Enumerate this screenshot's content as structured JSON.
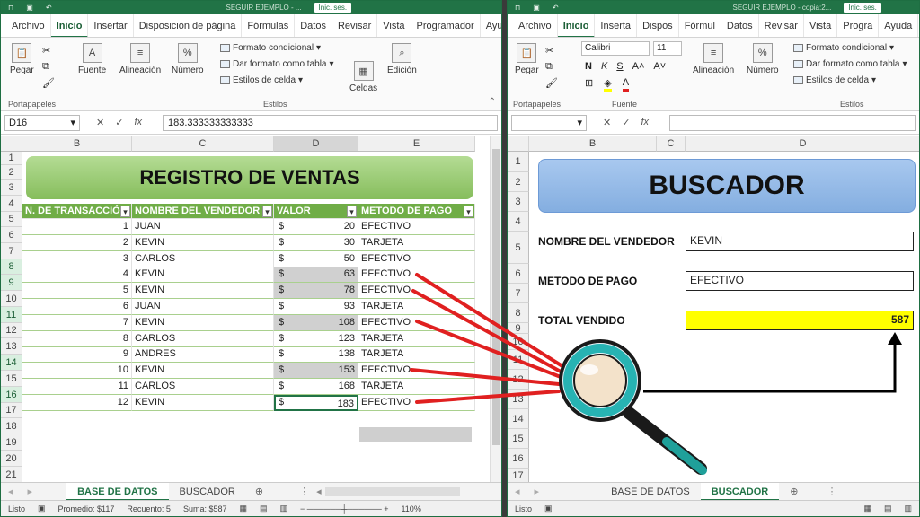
{
  "left": {
    "title": "SEGUIR EJEMPLO - ...",
    "signin": "Inic. ses.",
    "tabs": [
      "Archivo",
      "Inicio",
      "Insertar",
      "Disposición de página",
      "Fórmulas",
      "Datos",
      "Revisar",
      "Vista",
      "Programador",
      "Ayuda"
    ],
    "ribbon": {
      "pegar": "Pegar",
      "portapapeles": "Portapapeles",
      "fuente": "Fuente",
      "alineacion": "Alineación",
      "numero": "Número",
      "formato_condicional": "Formato condicional",
      "dar_formato": "Dar formato como tabla",
      "estilos_celda": "Estilos de celda",
      "estilos": "Estilos",
      "celdas": "Celdas",
      "edicion": "Edición"
    },
    "namebox": "D16",
    "formula": "183.333333333333",
    "columns": [
      "B",
      "C",
      "D",
      "E"
    ],
    "banner": "REGISTRO DE VENTAS",
    "headers": [
      "N. DE TRANSACCIÓN",
      "NOMBRE DEL VENDEDOR",
      "VALOR",
      "METODO DE PAGO"
    ],
    "rows": [
      {
        "n": "1",
        "name": "JUAN",
        "cur": "$",
        "val": "20",
        "pay": "EFECTIVO"
      },
      {
        "n": "2",
        "name": "KEVIN",
        "cur": "$",
        "val": "30",
        "pay": "TARJETA"
      },
      {
        "n": "3",
        "name": "CARLOS",
        "cur": "$",
        "val": "50",
        "pay": "EFECTIVO"
      },
      {
        "n": "4",
        "name": "KEVIN",
        "cur": "$",
        "val": "63",
        "pay": "EFECTIVO"
      },
      {
        "n": "5",
        "name": "KEVIN",
        "cur": "$",
        "val": "78",
        "pay": "EFECTIVO"
      },
      {
        "n": "6",
        "name": "JUAN",
        "cur": "$",
        "val": "93",
        "pay": "TARJETA"
      },
      {
        "n": "7",
        "name": "KEVIN",
        "cur": "$",
        "val": "108",
        "pay": "EFECTIVO"
      },
      {
        "n": "8",
        "name": "CARLOS",
        "cur": "$",
        "val": "123",
        "pay": "TARJETA"
      },
      {
        "n": "9",
        "name": "ANDRES",
        "cur": "$",
        "val": "138",
        "pay": "TARJETA"
      },
      {
        "n": "10",
        "name": "KEVIN",
        "cur": "$",
        "val": "153",
        "pay": "EFECTIVO"
      },
      {
        "n": "11",
        "name": "CARLOS",
        "cur": "$",
        "val": "168",
        "pay": "TARJETA"
      },
      {
        "n": "12",
        "name": "KEVIN",
        "cur": "$",
        "val": "183",
        "pay": "EFECTIVO"
      }
    ],
    "rownums": [
      "1",
      "2",
      "3",
      "4",
      "5",
      "6",
      "7",
      "8",
      "9",
      "10",
      "11",
      "12",
      "13",
      "14",
      "15",
      "16",
      "17",
      "18",
      "19",
      "20",
      "21"
    ],
    "sheets": [
      "BASE DE DATOS",
      "BUSCADOR"
    ],
    "status": {
      "ready": "Listo",
      "promedio": "Promedio: $117",
      "recuento": "Recuento: 5",
      "suma": "Suma: $587",
      "zoom": "110%"
    }
  },
  "right": {
    "title": "SEGUIR EJEMPLO - copia:2...",
    "signin": "Inic. ses.",
    "tabs": [
      "Archivo",
      "Inicio",
      "Inserta",
      "Dispos",
      "Fórmul",
      "Datos",
      "Revisar",
      "Vista",
      "Progra",
      "Ayuda"
    ],
    "ribbon": {
      "pegar": "Pegar",
      "portapapeles": "Portapapeles",
      "font": "Calibri",
      "size": "11",
      "fuente": "Fuente",
      "alineacion": "Alineación",
      "numero": "Número",
      "formato_condicional": "Formato condicional",
      "dar_formato": "Dar formato como tabla",
      "estilos_celda": "Estilos de celda",
      "estilos": "Estilos"
    },
    "columns": [
      "B",
      "C",
      "D"
    ],
    "banner": "BUSCADOR",
    "fields": {
      "vendedor_label": "NOMBRE DEL VENDEDOR",
      "vendedor_value": "KEVIN",
      "metodo_label": "METODO DE PAGO",
      "metodo_value": "EFECTIVO",
      "total_label": "TOTAL VENDIDO",
      "total_value": "587"
    },
    "rownums": [
      "1",
      "2",
      "3",
      "4",
      "5",
      "6",
      "7",
      "8",
      "9",
      "10",
      "11",
      "12",
      "13",
      "14",
      "15",
      "16",
      "17"
    ],
    "sheets": [
      "BASE DE DATOS",
      "BUSCADOR"
    ],
    "status": {
      "ready": "Listo"
    }
  },
  "colors": {
    "excel_green": "#217346",
    "banner_green": "#8fc46a",
    "banner_blue": "#8fb4e3",
    "highlight_yellow": "#ffff00",
    "arrow_red": "#e02020"
  }
}
